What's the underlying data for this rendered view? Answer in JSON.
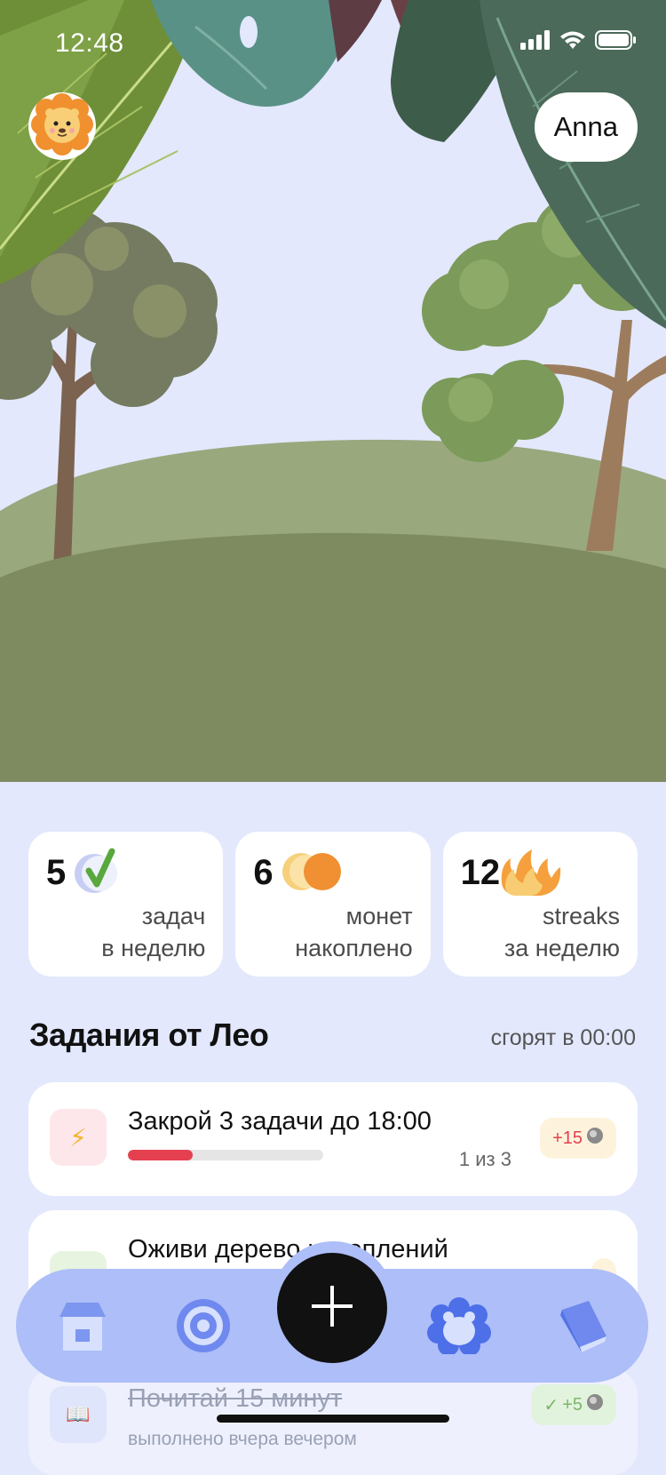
{
  "status": {
    "time": "12:48"
  },
  "profile": {
    "name": "Anna",
    "avatar_icon": "lion-icon"
  },
  "stats": [
    {
      "value": "5",
      "line1": "задач",
      "line2": "в неделю",
      "icon": "check-badge-icon"
    },
    {
      "value": "6",
      "line1": "монет",
      "line2": "накоплено",
      "icon": "coins-icon"
    },
    {
      "value": "12",
      "line1": "streaks",
      "line2": "за неделю",
      "icon": "flame-icon"
    }
  ],
  "tasks_section": {
    "title": "Задания от Лео",
    "note": "сгорят в 00:00",
    "tasks": [
      {
        "title": "Закрой 3 задачи до 18:00",
        "reward": "+15",
        "progress_text": "1 из 3",
        "progress": 0.33,
        "icon": "lightning-icon"
      },
      {
        "title": "Оживи дерево накоплений"
      },
      {
        "title": "Почитай 15 минут",
        "reward": "+5",
        "subtitle": "выполнено вчера вечером",
        "icon": "book-icon",
        "done": true
      }
    ]
  },
  "nav": {
    "items": [
      {
        "name": "home",
        "icon": "home-icon"
      },
      {
        "name": "goals",
        "icon": "target-icon"
      },
      {
        "name": "add",
        "icon": "plus-icon"
      },
      {
        "name": "pet",
        "icon": "bear-icon"
      },
      {
        "name": "journal",
        "icon": "book-icon"
      }
    ]
  },
  "colors": {
    "background": "#e3e8fd",
    "nav": "#adbef8",
    "accent_red": "#e54050",
    "progress_track": "#e5e5e5"
  }
}
